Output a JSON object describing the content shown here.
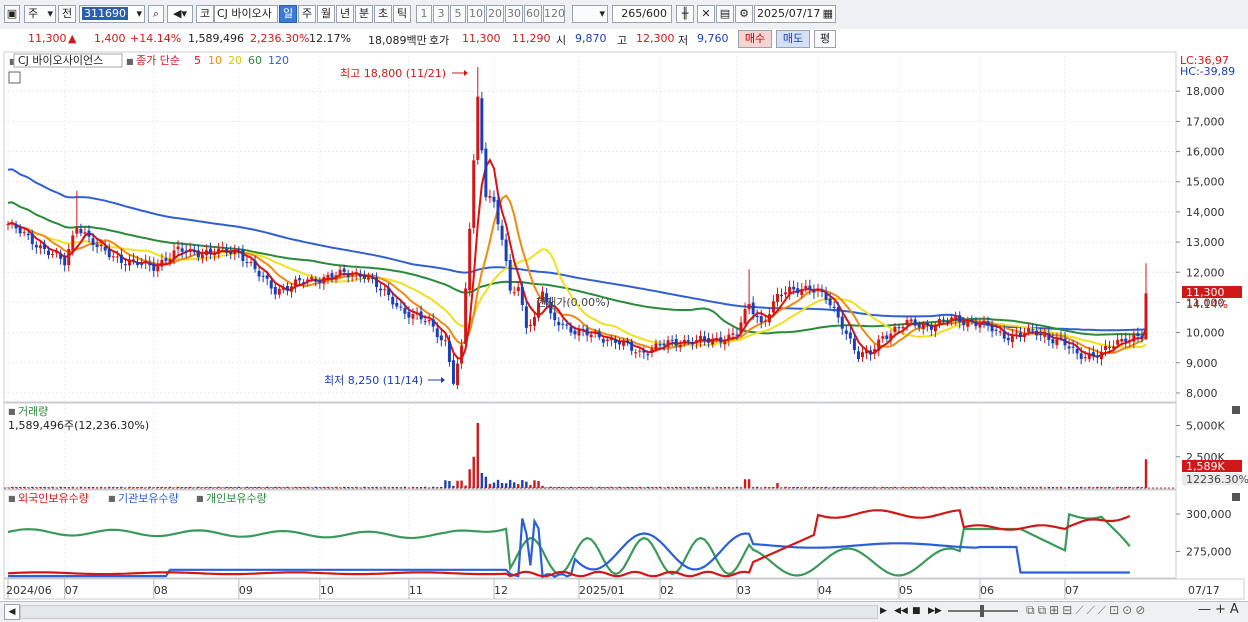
{
  "toolbar": {
    "period_label": "주",
    "prev_label": "전",
    "code": "311690",
    "market_label": "코",
    "stock_name": "CJ 바이오사",
    "tabs": [
      "일",
      "주",
      "월",
      "년",
      "분",
      "초",
      "틱"
    ],
    "active_tab": "일",
    "minute_options": [
      "1",
      "3",
      "5",
      "10",
      "20",
      "30",
      "60",
      "120"
    ],
    "count": "265",
    "count_total": "/600",
    "date": "2025/07/17"
  },
  "quote": {
    "price": "11,300",
    "arrow": "▲",
    "change": "1,400",
    "change_pct": "+14.14%",
    "volume": "1,589,496",
    "volume_pct": "2,236.30%",
    "turnover": "12.17%",
    "amount": "18,089백만",
    "bid_label": "호가",
    "ask": "11,300",
    "bid": "11,290",
    "open_label": "시",
    "open": "9,870",
    "high_label": "고",
    "high": "12,300",
    "low_label": "저",
    "low": "9,760",
    "buy_label": "매수",
    "sell_label": "매도",
    "eval_label": "평"
  },
  "legend": {
    "name": "CJ 바이오사이언스",
    "ma_label": "종가 단순",
    "ma_periods": [
      "5",
      "10",
      "20",
      "60",
      "120"
    ],
    "lc": "LC:36,97",
    "hc": "HC:-39,89"
  },
  "annotations": {
    "high": "최고 18,800 (11/21)",
    "low": "최저 8,250 (11/14)",
    "mid": "현재가(0.00%)",
    "price_tag": "11,300",
    "pct_tag": "14.14%"
  },
  "volume_panel": {
    "title": "거래량",
    "value": "1,589,496주(12,236.30%)",
    "tag1": "1,589K",
    "tag2": "12236.30%"
  },
  "holding_panel": {
    "series": [
      "외국인보유수량",
      "기관보유수량",
      "개인보유수량"
    ]
  },
  "x_axis": [
    "2024/06",
    "07",
    "08",
    "09",
    "10",
    "11",
    "12",
    "2025/01",
    "02",
    "03",
    "04",
    "05",
    "06",
    "07",
    "07/17"
  ],
  "chart_data": [
    {
      "type": "line",
      "title": "CJ 바이오사이언스",
      "y_ticks": [
        "18,000",
        "17,000",
        "16,000",
        "15,000",
        "14,000",
        "13,000",
        "12,000",
        "11,000",
        "10,000",
        "9,000",
        "8,000"
      ],
      "ylim": [
        7700,
        19300
      ],
      "x": [
        "2024/06",
        "07",
        "08",
        "09",
        "10",
        "11",
        "11/14",
        "11/21",
        "12",
        "2025/01",
        "02",
        "03",
        "04",
        "05",
        "06",
        "07",
        "07/17"
      ],
      "series": [
        {
          "name": "종가",
          "values": [
            13700,
            12700,
            12500,
            12600,
            12000,
            10200,
            8400,
            17800,
            10600,
            10000,
            9500,
            11300,
            10100,
            10200,
            9900,
            9300,
            11300
          ]
        }
      ]
    },
    {
      "type": "bar",
      "title": "거래량",
      "y_ticks": [
        "5,000K",
        "2,500K"
      ]
    },
    {
      "type": "line",
      "title": "",
      "y_ticks": [
        "300,000",
        "275,000"
      ],
      "series": [
        {
          "name": "외국인보유수량"
        },
        {
          "name": "기관보유수량"
        },
        {
          "name": "개인보유수량"
        }
      ]
    }
  ],
  "colors": {
    "up": "#d01818",
    "down": "#1a3fb8",
    "ma5": "#e01010",
    "ma10": "#f08a10",
    "ma20": "#f0e020",
    "ma60": "#2a8a3a",
    "ma120": "#3060d0",
    "foreign": "#d01818",
    "inst": "#2a5fd8",
    "indiv": "#3a9a5a"
  }
}
